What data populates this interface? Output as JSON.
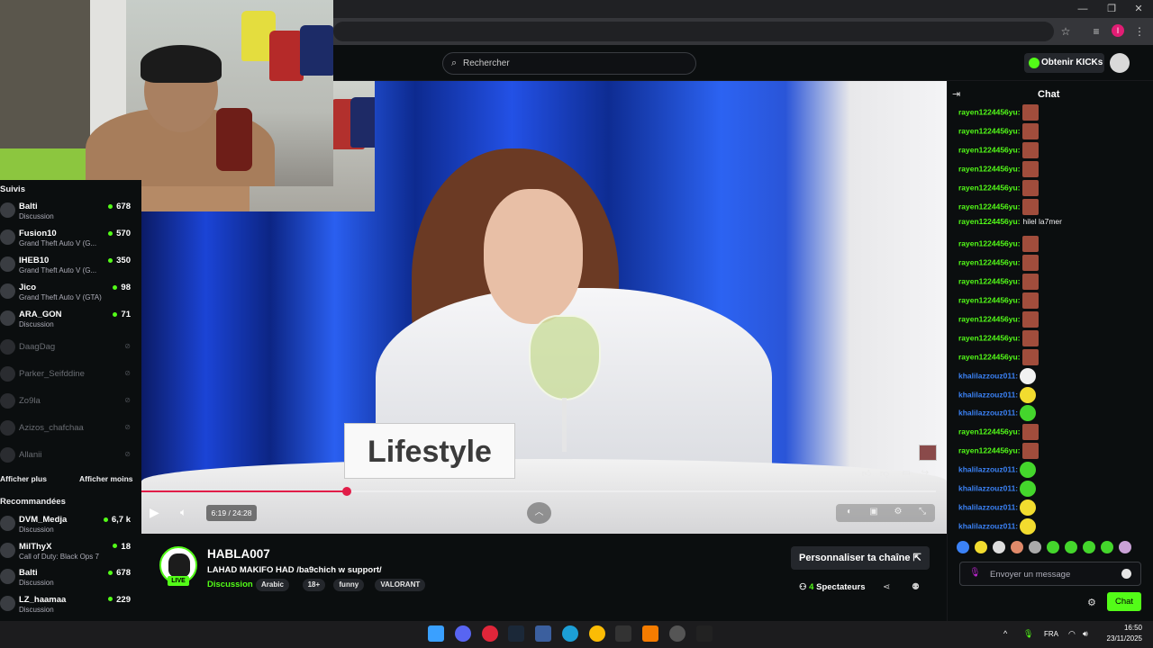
{
  "window": {
    "minimize": "—",
    "maximize": "❐",
    "close": "✕"
  },
  "header": {
    "search_placeholder": "Rechercher",
    "kicks_button": "Obtenir KICKs"
  },
  "sidebar": {
    "followed_title": "Suivis",
    "followed": [
      {
        "name": "Balti",
        "category": "Discussion",
        "viewers": "678"
      },
      {
        "name": "Fusion10",
        "category": "Grand Theft Auto V (G...",
        "viewers": "570"
      },
      {
        "name": "IHEB10",
        "category": "Grand Theft Auto V (G...",
        "viewers": "350"
      },
      {
        "name": "Jico",
        "category": "Grand Theft Auto V (GTA)",
        "viewers": "98"
      },
      {
        "name": "ARA_GON",
        "category": "Discussion",
        "viewers": "71"
      }
    ],
    "offline": [
      {
        "name": "DaagDag"
      },
      {
        "name": "Parker_Seifddine"
      },
      {
        "name": "Zo9la"
      },
      {
        "name": "Azizos_chafchaa"
      },
      {
        "name": "Allanii"
      }
    ],
    "show_more": "Afficher plus",
    "show_less": "Afficher moins",
    "recommended_title": "Recommandées",
    "recommended": [
      {
        "name": "DVM_Medja",
        "category": "Discussion",
        "viewers": "6,7 k"
      },
      {
        "name": "MiIThyX",
        "category": "Call of Duty: Black Ops 7",
        "viewers": "18"
      },
      {
        "name": "Balti",
        "category": "Discussion",
        "viewers": "678"
      },
      {
        "name": "LZ_haamaa",
        "category": "Discussion",
        "viewers": "229"
      }
    ]
  },
  "video": {
    "sign_text": "Lifestyle",
    "time": "6:19 / 24:28",
    "progress": 0.258
  },
  "stream": {
    "live_badge": "LIVE",
    "streamer": "HABLA007",
    "title": "LAHAD MAKIFO HAD  /ba9chich w support/",
    "category": "Discussion",
    "tags": [
      "Arabic",
      "18+",
      "funny",
      "VALORANT"
    ],
    "customize": "Personnaliser ta chaîne ⇱",
    "viewers_count": "4",
    "viewers_label": "Spectateurs"
  },
  "chat": {
    "title": "Chat",
    "messages": [
      {
        "user": "rayen1224456yu:",
        "text": "",
        "emote": "red",
        "color": "green"
      },
      {
        "user": "rayen1224456yu:",
        "text": "",
        "emote": "red",
        "color": "green"
      },
      {
        "user": "rayen1224456yu:",
        "text": "",
        "emote": "red",
        "color": "green"
      },
      {
        "user": "rayen1224456yu:",
        "text": "",
        "emote": "red",
        "color": "green"
      },
      {
        "user": "rayen1224456yu:",
        "text": "",
        "emote": "red",
        "color": "green"
      },
      {
        "user": "rayen1224456yu:",
        "text": "",
        "emote": "red",
        "color": "green"
      },
      {
        "user": "rayen1224456yu:",
        "text": "hilel la7mer",
        "emote": "",
        "color": "green"
      },
      {
        "user": "rayen1224456yu:",
        "text": "",
        "emote": "red",
        "color": "green"
      },
      {
        "user": "rayen1224456yu:",
        "text": "",
        "emote": "red",
        "color": "green"
      },
      {
        "user": "rayen1224456yu:",
        "text": "",
        "emote": "red",
        "color": "green"
      },
      {
        "user": "rayen1224456yu:",
        "text": "",
        "emote": "red",
        "color": "green"
      },
      {
        "user": "rayen1224456yu:",
        "text": "",
        "emote": "red",
        "color": "green"
      },
      {
        "user": "rayen1224456yu:",
        "text": "",
        "emote": "red",
        "color": "green"
      },
      {
        "user": "rayen1224456yu:",
        "text": "",
        "emote": "red",
        "color": "green"
      },
      {
        "user": "khalilazzouz011:",
        "text": "",
        "emote": "white",
        "color": "blue"
      },
      {
        "user": "khalilazzouz011:",
        "text": "",
        "emote": "yellow",
        "color": "blue"
      },
      {
        "user": "khalilazzouz011:",
        "text": "",
        "emote": "green",
        "color": "blue"
      },
      {
        "user": "rayen1224456yu:",
        "text": "",
        "emote": "red",
        "color": "green"
      },
      {
        "user": "rayen1224456yu:",
        "text": "",
        "emote": "red",
        "color": "green"
      },
      {
        "user": "khalilazzouz011:",
        "text": "",
        "emote": "green",
        "color": "blue"
      },
      {
        "user": "khalilazzouz011:",
        "text": "",
        "emote": "green",
        "color": "blue"
      },
      {
        "user": "khalilazzouz011:",
        "text": "",
        "emote": "yellow",
        "color": "blue"
      },
      {
        "user": "khalilazzouz011:",
        "text": "",
        "emote": "yellow",
        "color": "blue"
      }
    ],
    "input_placeholder": "Envoyer un message",
    "send_button": "Chat"
  },
  "taskbar": {
    "lang": "FRA",
    "time": "16:50",
    "date": "23/11/2025"
  },
  "colors": {
    "brand": "#53fc18",
    "progress": "#e11d48",
    "chat_user_green": "#53fc18",
    "chat_user_blue": "#3b82f6"
  }
}
